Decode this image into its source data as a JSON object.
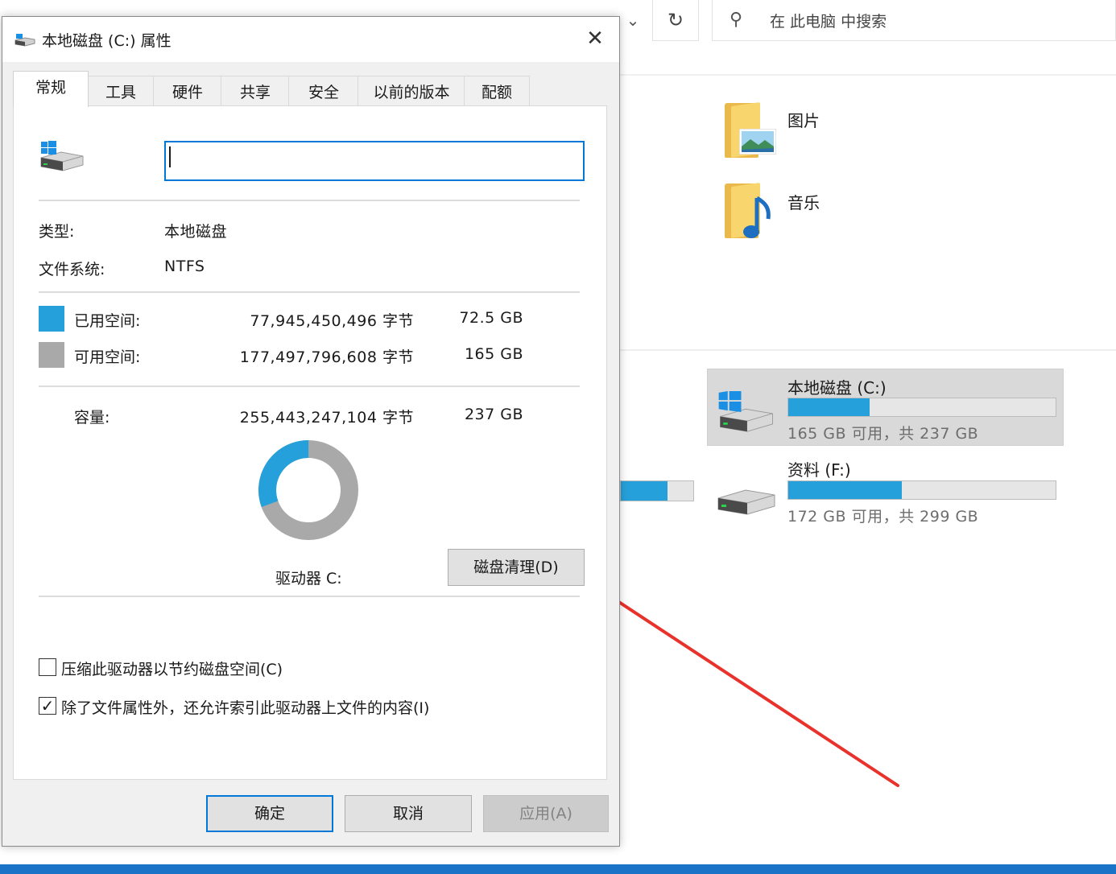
{
  "explorer": {
    "search_placeholder": "在 此电脑 中搜索",
    "folders": [
      {
        "label": "图片",
        "icon": "pictures-folder-icon"
      },
      {
        "label": "音乐",
        "icon": "music-folder-icon"
      }
    ],
    "drives": [
      {
        "name": "本地磁盘 (C:)",
        "free_text": "165 GB 可用，共 237 GB",
        "used_fraction": 0.305,
        "selected": true
      },
      {
        "name": "资料 (F:)",
        "free_text": "172 GB 可用，共 299 GB",
        "used_fraction": 0.425,
        "selected": false
      }
    ],
    "accent_color": "#26a0da"
  },
  "dialog": {
    "title": "本地磁盘 (C:) 属性",
    "tabs": [
      "常规",
      "工具",
      "硬件",
      "共享",
      "安全",
      "以前的版本",
      "配额"
    ],
    "active_tab": "常规",
    "volume_name_value": "",
    "type_label": "类型:",
    "type_value": "本地磁盘",
    "fs_label": "文件系统:",
    "fs_value": "NTFS",
    "used_label": "已用空间:",
    "used_bytes": "77,945,450,496 字节",
    "used_size": "72.5 GB",
    "free_label": "可用空间:",
    "free_bytes": "177,497,796,608 字节",
    "free_size": "165 GB",
    "capacity_label": "容量:",
    "capacity_bytes": "255,443,247,104 字节",
    "capacity_size": "237 GB",
    "used_fraction": 0.305,
    "used_color": "#26a0da",
    "free_color": "#a9a9a9",
    "drive_label": "驱动器 C:",
    "cleanup_button": "磁盘清理(D)",
    "compress_label": "压缩此驱动器以节约磁盘空间(C)",
    "compress_checked": false,
    "index_label": "除了文件属性外，还允许索引此驱动器上文件的内容(I)",
    "index_checked": true,
    "ok_button": "确定",
    "cancel_button": "取消",
    "apply_button": "应用(A)"
  }
}
